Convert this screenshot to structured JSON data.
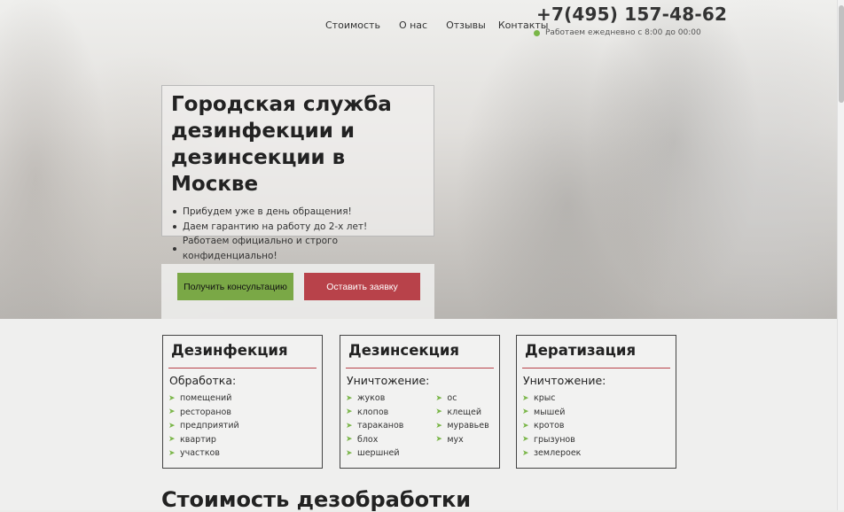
{
  "nav": {
    "items": [
      "Стоимость",
      "О нас",
      "Отзывы",
      "Контакты"
    ]
  },
  "contact": {
    "phone": "+7(495) 157-48-62",
    "hours": "Работаем ежедневно с 8:00 до 00:00"
  },
  "hero": {
    "title_lines": [
      "Городская служба",
      "дезинфекции и",
      "дезинсекции в Москве"
    ],
    "bullets": [
      "Прибудем уже в день обращения!",
      "Даем гарантию на работу до 2-х лет!",
      "Работаем официально и строго конфиденциально!"
    ],
    "btn_consult": "Получить консультацию",
    "btn_request": "Оставить заявку"
  },
  "cards": [
    {
      "title": "Дезинфекция",
      "subtitle": "Обработка:",
      "col1": [
        "помещений",
        "ресторанов",
        "предприятий",
        "квартир",
        "участков"
      ],
      "col2": []
    },
    {
      "title": "Дезинсекция",
      "subtitle": "Уничтожение:",
      "col1": [
        "жуков",
        "клопов",
        "тараканов",
        "блох",
        "шершней"
      ],
      "col2": [
        "ос",
        "клещей",
        "муравьев",
        "мух"
      ]
    },
    {
      "title": "Дератизация",
      "subtitle": "Уничтожение:",
      "col1": [
        "крыс",
        "мышей",
        "кротов",
        "грызунов",
        "землероек"
      ],
      "col2": []
    }
  ],
  "pricing": {
    "title": "Стоимость дезобработки"
  },
  "colors": {
    "accent_green": "#7aa846",
    "accent_red": "#b8424a",
    "status_dot": "#7ab648"
  }
}
